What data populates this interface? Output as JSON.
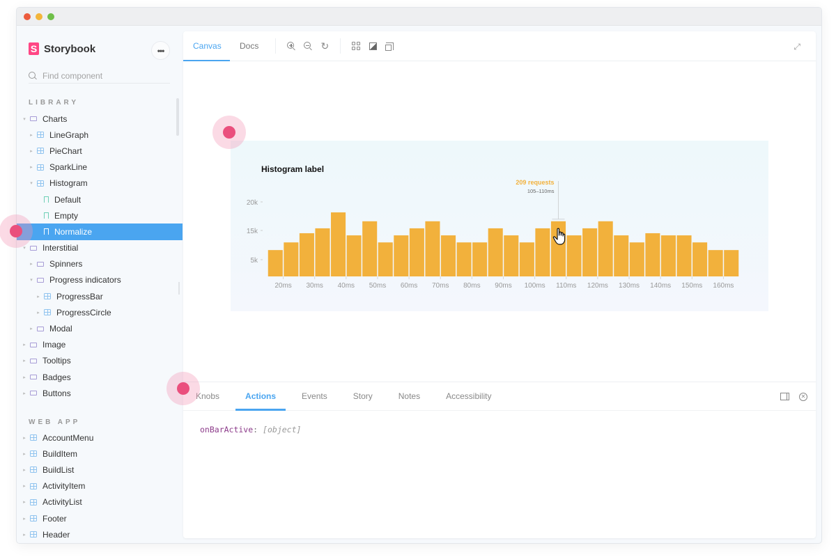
{
  "window": {
    "traffic_lights": [
      "close",
      "minimize",
      "maximize"
    ]
  },
  "sidebar": {
    "brand": {
      "logo": "S",
      "name": "Storybook"
    },
    "more_button": "•••",
    "search": {
      "placeholder": "Find component",
      "value": ""
    },
    "sections": [
      {
        "label": "LIBRARY",
        "items": [
          {
            "label": "Charts",
            "type": "folder",
            "depth": 0,
            "expanded": true
          },
          {
            "label": "LineGraph",
            "type": "component",
            "depth": 1,
            "expanded": false
          },
          {
            "label": "PieChart",
            "type": "component",
            "depth": 1,
            "expanded": false
          },
          {
            "label": "SparkLine",
            "type": "component",
            "depth": 1,
            "expanded": false
          },
          {
            "label": "Histogram",
            "type": "component",
            "depth": 1,
            "expanded": true
          },
          {
            "label": "Default",
            "type": "story",
            "depth": 2
          },
          {
            "label": "Empty",
            "type": "story",
            "depth": 2
          },
          {
            "label": "Normalize",
            "type": "story",
            "depth": 2,
            "selected": true
          },
          {
            "label": "Interstitial",
            "type": "folder",
            "depth": 0,
            "expanded": true
          },
          {
            "label": "Spinners",
            "type": "folder",
            "depth": 1,
            "expanded": false
          },
          {
            "label": "Progress indicators",
            "type": "folder",
            "depth": 1,
            "expanded": true
          },
          {
            "label": "ProgressBar",
            "type": "component",
            "depth": 2,
            "expanded": false
          },
          {
            "label": "ProgressCircle",
            "type": "component",
            "depth": 2,
            "expanded": false
          },
          {
            "label": "Modal",
            "type": "folder",
            "depth": 1,
            "expanded": false
          },
          {
            "label": "Image",
            "type": "folder",
            "depth": 0,
            "expanded": false
          },
          {
            "label": "Tooltips",
            "type": "folder",
            "depth": 0,
            "expanded": false
          },
          {
            "label": "Badges",
            "type": "folder",
            "depth": 0,
            "expanded": false
          },
          {
            "label": "Buttons",
            "type": "folder",
            "depth": 0,
            "expanded": false
          }
        ]
      },
      {
        "label": "WEB APP",
        "items": [
          {
            "label": "AccountMenu",
            "type": "component",
            "depth": 0
          },
          {
            "label": "BuildItem",
            "type": "component",
            "depth": 0
          },
          {
            "label": "BuildList",
            "type": "component",
            "depth": 0
          },
          {
            "label": "ActivityItem",
            "type": "component",
            "depth": 0
          },
          {
            "label": "ActivityList",
            "type": "component",
            "depth": 0
          },
          {
            "label": "Footer",
            "type": "component",
            "depth": 0
          },
          {
            "label": "Header",
            "type": "component",
            "depth": 0
          }
        ]
      }
    ]
  },
  "toolbar": {
    "tabs": [
      {
        "label": "Canvas",
        "active": true
      },
      {
        "label": "Docs",
        "active": false
      }
    ],
    "icons": [
      "zoom-in-icon",
      "zoom-out-icon",
      "zoom-reset-icon",
      "grid-icon",
      "background-icon",
      "outline-icon"
    ],
    "fullscreen_icon": "fullscreen-icon"
  },
  "chart_data": {
    "type": "bar",
    "title": "Histogram label",
    "xlabel": "",
    "ylabel": "",
    "y_tick_labels": [
      "20k",
      "15k",
      "5k"
    ],
    "x_tick_labels": [
      "20ms",
      "30ms",
      "40ms",
      "50ms",
      "60ms",
      "70ms",
      "80ms",
      "90ms",
      "100ms",
      "110ms",
      "120ms",
      "130ms",
      "140ms",
      "150ms",
      "160ms"
    ],
    "bin_start_ms": 15,
    "bin_width_ms": 5,
    "values": [
      8.6,
      11.1,
      14.1,
      15.7,
      20.9,
      13.4,
      18.0,
      11.1,
      13.4,
      15.7,
      18.0,
      13.4,
      11.1,
      11.1,
      15.7,
      13.4,
      11.1,
      15.7,
      18.0,
      13.4,
      15.7,
      18.0,
      13.4,
      11.1,
      14.1,
      13.4,
      13.4,
      11.1,
      8.6,
      8.6
    ],
    "value_units": "k",
    "ylim": [
      0,
      24
    ],
    "grid": false,
    "bar_color": "#f2b13c",
    "tooltip": {
      "bar_index": 18,
      "title": "209 requests",
      "subtitle": "105–110ms"
    }
  },
  "addons": {
    "tabs": [
      {
        "label": "Knobs",
        "active": false
      },
      {
        "label": "Actions",
        "active": true
      },
      {
        "label": "Events",
        "active": false
      },
      {
        "label": "Story",
        "active": false
      },
      {
        "label": "Notes",
        "active": false
      },
      {
        "label": "Accessibility",
        "active": false
      }
    ],
    "actions": [
      {
        "name": "onBarActive",
        "separator": ":",
        "value": "[object]"
      }
    ]
  },
  "colors": {
    "accent": "#4aa5f0",
    "brand": "#ff4785",
    "bar": "#f2b13c",
    "click_indicator": "#ea4f7d"
  }
}
